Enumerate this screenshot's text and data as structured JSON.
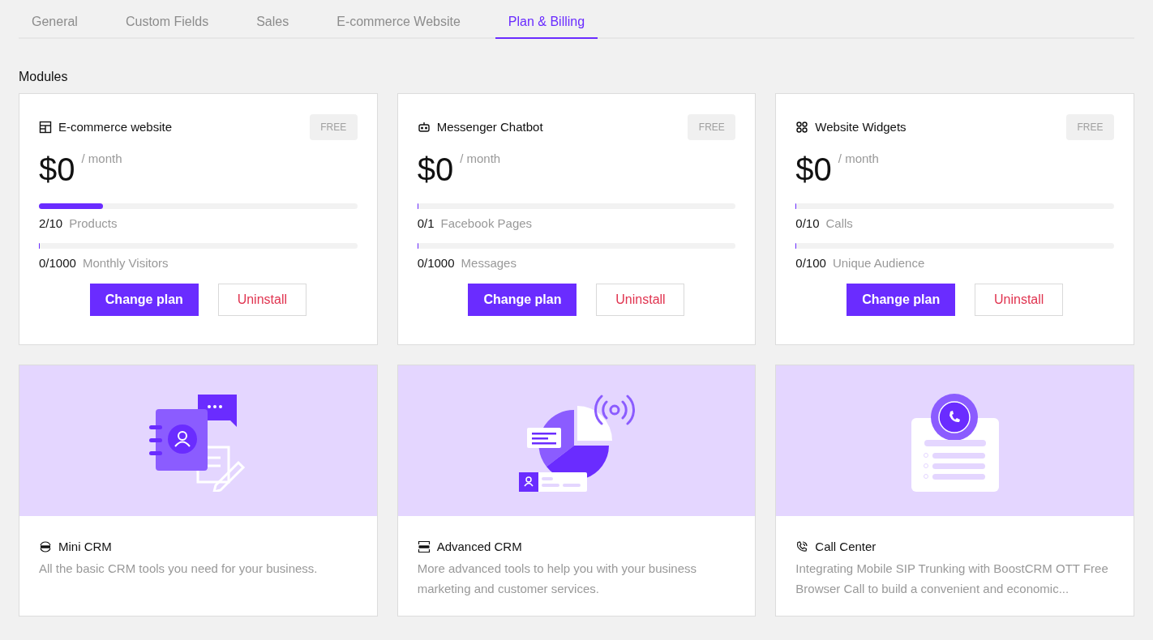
{
  "tabs": [
    {
      "label": "General",
      "selected": false
    },
    {
      "label": "Custom Fields",
      "selected": false
    },
    {
      "label": "Sales",
      "selected": false
    },
    {
      "label": "E-commerce Website",
      "selected": false
    },
    {
      "label": "Plan & Billing",
      "selected": true
    }
  ],
  "section_title": "Modules",
  "plans": [
    {
      "name": "E-commerce website",
      "badge": "FREE",
      "price": "$0",
      "period": "/ month",
      "usage": [
        {
          "count": "2/10",
          "label": "Products",
          "level": 0.2
        },
        {
          "count": "0/1000",
          "label": "Monthly Visitors",
          "level": 0
        }
      ],
      "primary_button": "Change plan",
      "secondary_button": "Uninstall"
    },
    {
      "name": "Messenger Chatbot",
      "badge": "FREE",
      "price": "$0",
      "period": "/ month",
      "usage": [
        {
          "count": "0/1",
          "label": "Facebook Pages",
          "level": 0
        },
        {
          "count": "0/1000",
          "label": "Messages",
          "level": 0
        }
      ],
      "primary_button": "Change plan",
      "secondary_button": "Uninstall"
    },
    {
      "name": "Website Widgets",
      "badge": "FREE",
      "price": "$0",
      "period": "/ month",
      "usage": [
        {
          "count": "0/10",
          "label": "Calls",
          "level": 0
        },
        {
          "count": "0/100",
          "label": "Unique Audience",
          "level": 0
        }
      ],
      "primary_button": "Change plan",
      "secondary_button": "Uninstall"
    }
  ],
  "addons": [
    {
      "name": "Mini CRM",
      "description": "All the basic CRM tools you need for your business."
    },
    {
      "name": "Advanced CRM",
      "description": "More advanced tools to help you with your business marketing and customer services."
    },
    {
      "name": "Call Center",
      "description": "Integrating Mobile SIP Trunking with BoostCRM OTT Free Browser Call to build a convenient and economic..."
    }
  ]
}
